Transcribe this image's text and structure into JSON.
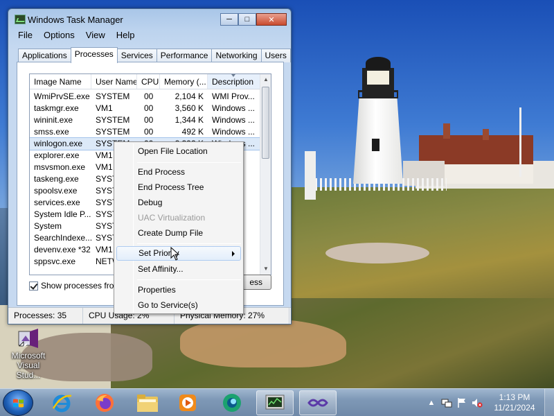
{
  "window": {
    "title": "Windows Task Manager",
    "controls": {
      "minimize": "─",
      "maximize": "□",
      "close": "✕"
    }
  },
  "menu": [
    "File",
    "Options",
    "View",
    "Help"
  ],
  "tabs": [
    "Applications",
    "Processes",
    "Services",
    "Performance",
    "Networking",
    "Users"
  ],
  "active_tab": "Processes",
  "table": {
    "columns": [
      "Image Name",
      "User Name",
      "CPU",
      "Memory (...",
      "Description"
    ],
    "rows": [
      {
        "name": "WmiPrvSE.exe",
        "user": "SYSTEM",
        "cpu": "00",
        "mem": "2,104 K",
        "desc": "WMI Prov..."
      },
      {
        "name": "taskmgr.exe",
        "user": "VM1",
        "cpu": "00",
        "mem": "3,560 K",
        "desc": "Windows ..."
      },
      {
        "name": "wininit.exe",
        "user": "SYSTEM",
        "cpu": "00",
        "mem": "1,344 K",
        "desc": "Windows ..."
      },
      {
        "name": "smss.exe",
        "user": "SYSTEM",
        "cpu": "00",
        "mem": "492 K",
        "desc": "Windows ..."
      },
      {
        "name": "winlogon.exe",
        "user": "SYSTEM",
        "cpu": "00",
        "mem": "2,392 K",
        "desc": "Windows ..."
      },
      {
        "name": "explorer.exe",
        "user": "VM1",
        "cpu": "",
        "mem": "",
        "desc": "..."
      },
      {
        "name": "msvsmon.exe",
        "user": "VM1",
        "cpu": "",
        "mem": "",
        "desc": "..."
      },
      {
        "name": "taskeng.exe",
        "user": "SYST",
        "cpu": "",
        "mem": "",
        "desc": "..."
      },
      {
        "name": "spoolsv.exe",
        "user": "SYST",
        "cpu": "",
        "mem": "",
        "desc": "..."
      },
      {
        "name": "services.exe",
        "user": "SYST",
        "cpu": "",
        "mem": "",
        "desc": "..."
      },
      {
        "name": "System Idle P...",
        "user": "SYST",
        "cpu": "",
        "mem": "",
        "desc": "..."
      },
      {
        "name": "System",
        "user": "SYST",
        "cpu": "",
        "mem": "",
        "desc": "..."
      },
      {
        "name": "SearchIndexe...",
        "user": "SYST",
        "cpu": "",
        "mem": "",
        "desc": "..."
      },
      {
        "name": "devenv.exe *32",
        "user": "VM1",
        "cpu": "",
        "mem": "",
        "desc": "..."
      },
      {
        "name": "sppsvc.exe",
        "user": "NETW",
        "cpu": "",
        "mem": "",
        "desc": "..."
      }
    ],
    "selected_row": 4
  },
  "show_all_label": "Show processes from",
  "end_process_label": "ess",
  "status": {
    "processes": "Processes: 35",
    "cpu": "CPU Usage: 2%",
    "memory": "Physical Memory: 27%"
  },
  "context_menu": {
    "items": [
      {
        "label": "Open File Location",
        "enabled": true
      },
      {
        "label": "End Process",
        "enabled": true
      },
      {
        "label": "End Process Tree",
        "enabled": true
      },
      {
        "label": "Debug",
        "enabled": true
      },
      {
        "label": "UAC Virtualization",
        "enabled": false
      },
      {
        "label": "Create Dump File",
        "enabled": true
      },
      {
        "label": "Set Priority",
        "enabled": true,
        "submenu": true
      },
      {
        "label": "Set Affinity...",
        "enabled": true
      },
      {
        "label": "Properties",
        "enabled": true
      },
      {
        "label": "Go to Service(s)",
        "enabled": true
      }
    ],
    "hovered": "Set Priority"
  },
  "desktop_icon": {
    "label_line1": "Microsoft",
    "label_line2": "Visual Stud...",
    "icon": "visual-studio-icon"
  },
  "taskbar": {
    "pinned": [
      "ie-icon",
      "firefox-icon",
      "explorer-folder-icon",
      "media-player-icon",
      "chrome-like-icon",
      "task-manager-icon",
      "visual-studio-icon"
    ],
    "clock_time": "1:13 PM",
    "clock_date": "11/21/2024",
    "tray_icons": [
      "show-hidden-icons-arrow",
      "network-icon",
      "action-center-flag-icon",
      "volume-muted-icon"
    ]
  },
  "colors": {
    "selection": "#dce9f8",
    "window_frame": "#c6d9f0",
    "close_button": "#c94b2f",
    "taskbar": "#7e98b6"
  }
}
